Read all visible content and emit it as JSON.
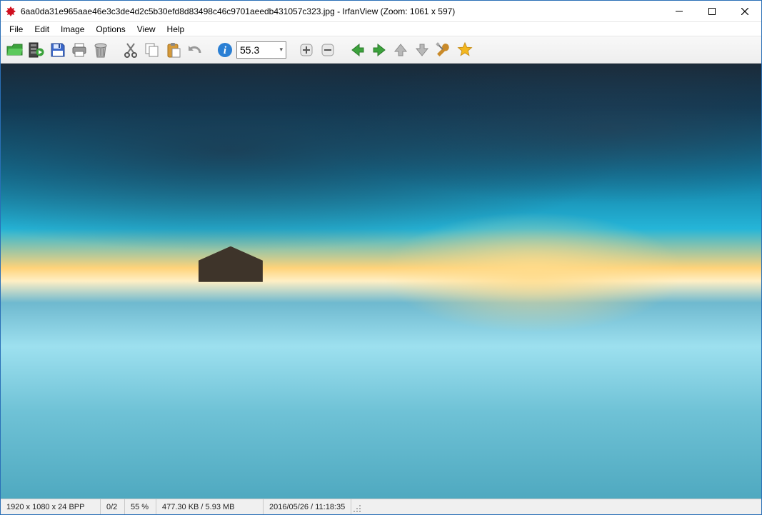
{
  "window": {
    "title": "6aa0da31e965aae46e3c3de4d2c5b30efd8d83498c46c9701aeedb431057c323.jpg - IrfanView (Zoom: 1061 x 597)"
  },
  "menu": {
    "items": [
      "File",
      "Edit",
      "Image",
      "Options",
      "View",
      "Help"
    ]
  },
  "toolbar": {
    "zoom_value": "55.3",
    "icons": {
      "open": "open-icon",
      "slideshow": "slideshow-icon",
      "save": "save-icon",
      "print": "print-icon",
      "delete": "delete-icon",
      "cut": "cut-icon",
      "copy": "copy-icon",
      "paste": "paste-icon",
      "undo": "undo-icon",
      "info": "info-icon",
      "zoom_in": "zoom-in-icon",
      "zoom_out": "zoom-out-icon",
      "prev": "prev-icon",
      "next": "next-icon",
      "up": "up-icon",
      "down": "down-icon",
      "tools": "tools-icon",
      "favorite": "favorite-icon"
    }
  },
  "status": {
    "dimensions": "1920 x 1080 x 24 BPP",
    "index": "0/2",
    "zoom_pct": "55 %",
    "filesize": "477.30 KB / 5.93 MB",
    "datetime": "2016/05/26 / 11:18:35"
  }
}
